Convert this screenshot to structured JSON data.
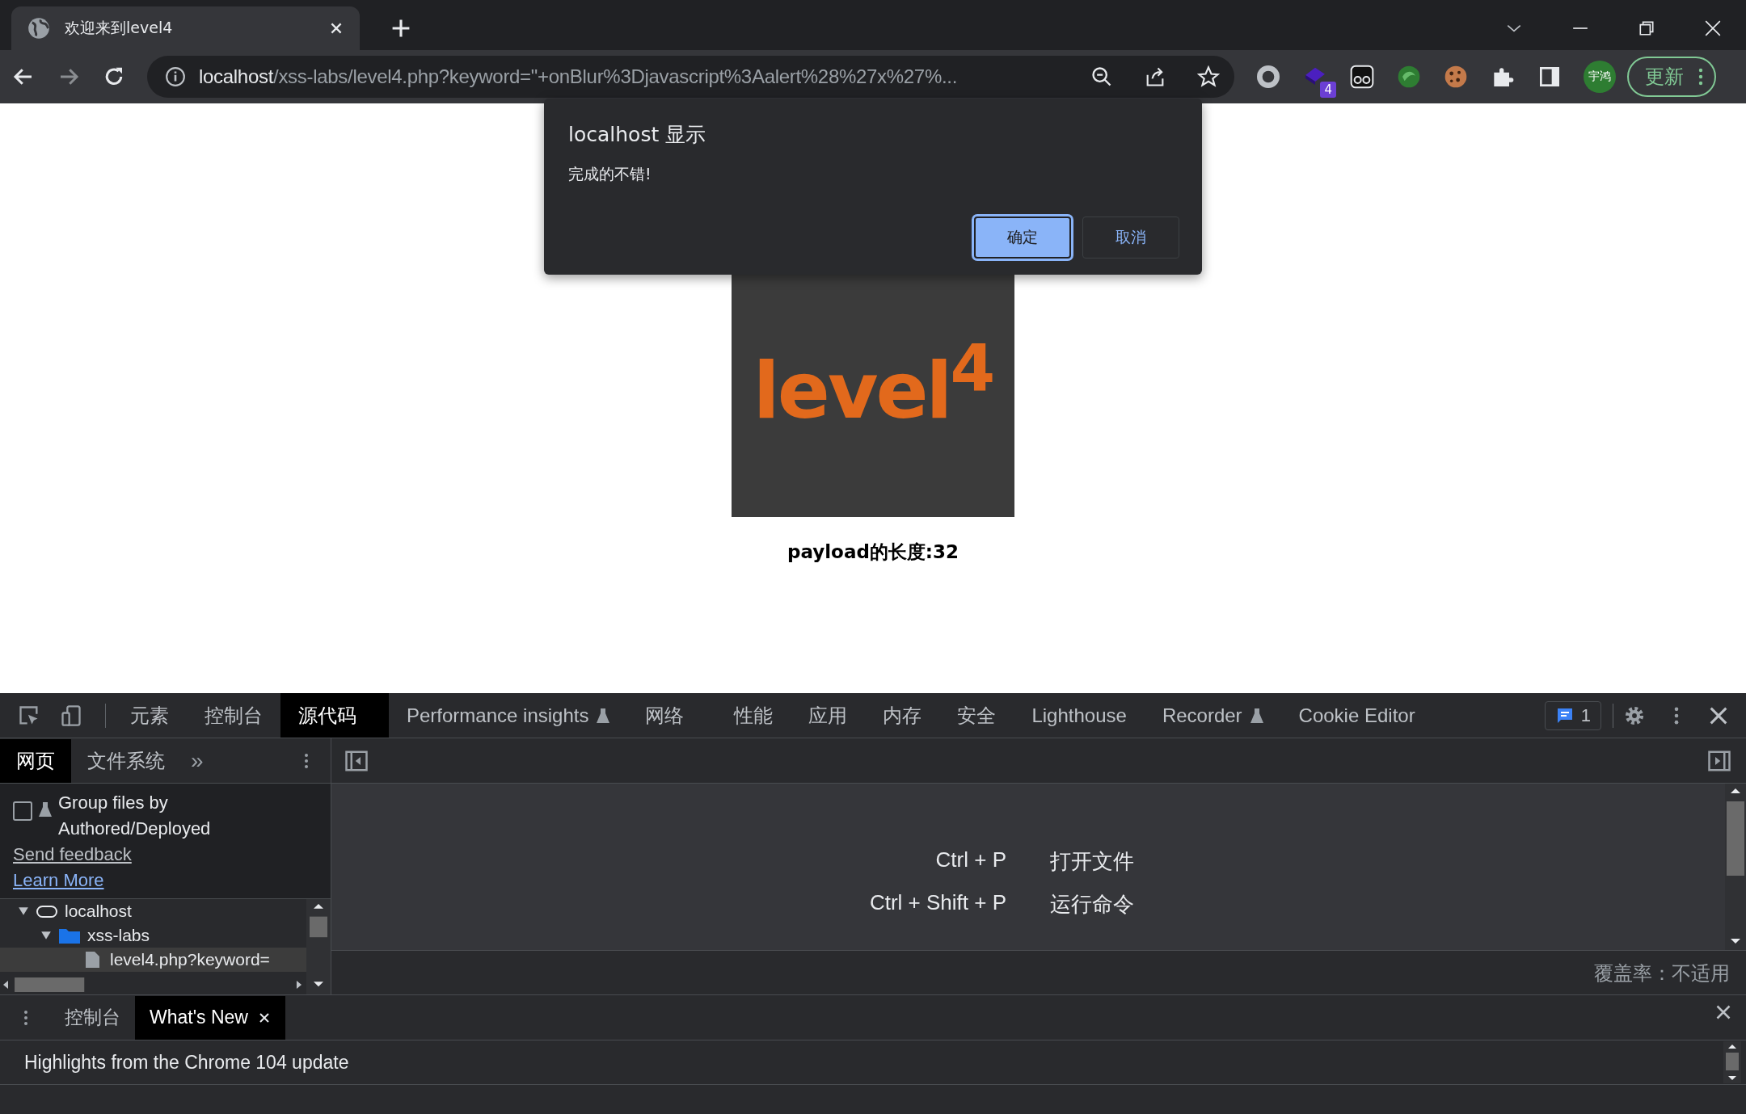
{
  "browser": {
    "tabs": [
      {
        "title": "欢迎来到level4",
        "selected": true
      }
    ],
    "url": {
      "host": "localhost",
      "path": "/xss-labs/level4.php?keyword=\"+onBlur%3Djavascript%3Aalert%28%27x%27%..."
    },
    "extension_badge": "4",
    "profile": "宇鸿",
    "update_button": "更新"
  },
  "dialog": {
    "title": "localhost 显示",
    "message": "完成的不错!",
    "buttons": [
      {
        "label": "确定",
        "selected": true
      },
      {
        "label": "取消",
        "selected": false
      }
    ]
  },
  "page": {
    "logo": "level$^{4}$",
    "payload_text": "payload的长度:32"
  },
  "devtools": {
    "tabs": [
      {
        "label": "元素",
        "selected": false,
        "experimental": false
      },
      {
        "label": "控制台",
        "selected": false,
        "experimental": false
      },
      {
        "label": "源代码",
        "selected": true,
        "experimental": false
      },
      {
        "label": "Performance insights",
        "selected": false,
        "experimental": true
      },
      {
        "label": "网络",
        "selected": false,
        "experimental": false
      },
      {
        "label": "性能",
        "selected": false,
        "experimental": false
      },
      {
        "label": "应用",
        "selected": false,
        "experimental": false
      },
      {
        "label": "内存",
        "selected": false,
        "experimental": false
      },
      {
        "label": "安全",
        "selected": false,
        "experimental": false
      },
      {
        "label": "Lighthouse",
        "selected": false,
        "experimental": false
      },
      {
        "label": "Recorder",
        "selected": false,
        "experimental": true
      },
      {
        "label": "Cookie Editor",
        "selected": false,
        "experimental": false
      }
    ],
    "issues_count": "1",
    "navigator_tabs": [
      {
        "label": "网页",
        "selected": true
      },
      {
        "label": "文件系统",
        "selected": false
      }
    ],
    "more": "»",
    "group_files": {
      "label": "Group files by Authored/Deployed",
      "checked": false
    },
    "links": [
      "Send feedback",
      "Learn More"
    ],
    "tree": [
      {
        "label": "localhost",
        "kind": "host",
        "expanded": true,
        "children": [
          {
            "label": "xss-labs",
            "kind": "folder",
            "expanded": true,
            "children": [
              {
                "label": "level4.php?keyword=",
                "kind": "file",
                "selected": true
              }
            ]
          }
        ]
      }
    ],
    "shortcuts": [
      {
        "keys": "Ctrl + P",
        "action": "打开文件"
      },
      {
        "keys": "Ctrl + Shift + P",
        "action": "运行命令"
      }
    ],
    "coverage": "覆盖率：不适用",
    "drawer_tabs": [
      {
        "label": "控制台",
        "selected": false,
        "closable": false
      },
      {
        "label": "What's New",
        "selected": true,
        "closable": true
      }
    ],
    "highlight": "Highlights from the Chrome 104 update"
  }
}
